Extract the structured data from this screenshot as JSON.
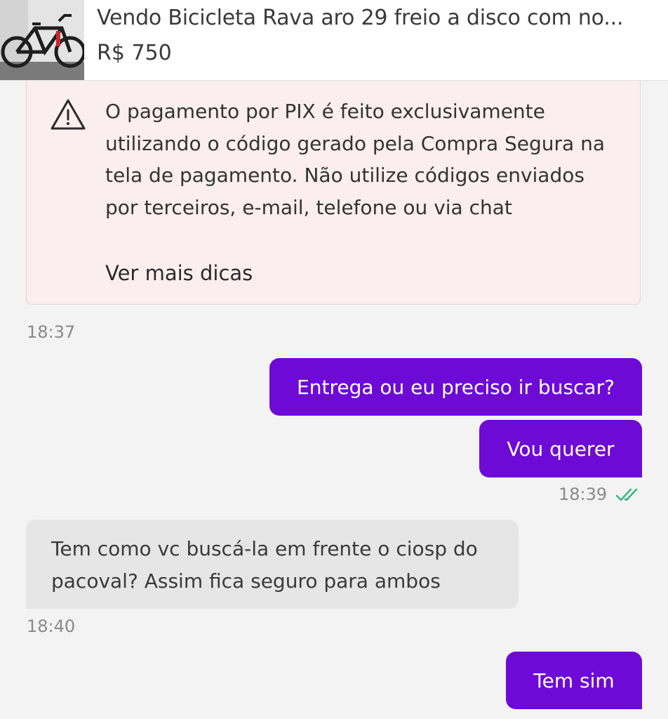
{
  "listing": {
    "title": "Vendo Bicicleta Rava aro 29 freio a disco com no...",
    "price": "R$ 750"
  },
  "warning": {
    "icon": "warning-triangle-icon",
    "text": "O pagamento por PIX é feito exclusivamente utilizando o código gerado pela Compra Segura na tela de pagamento. Não utilize códigos enviados por terceiros, e-mail, telefone ou via chat",
    "link": "Ver mais dicas",
    "colors": {
      "background": "#fbeeee",
      "border": "#e6d5d5"
    }
  },
  "messages": {
    "warning_time": "18:37",
    "sent_1": "Entrega ou eu preciso ir buscar?",
    "sent_2": "Vou querer",
    "sent_time": "18:39",
    "received_1": "Tem como vc buscá-la em frente o ciosp do pacoval? Assim fica seguro para ambos",
    "received_time": "18:40",
    "sent_3": "Tem sim"
  },
  "colors": {
    "sent_bubble": "#6e0ad6",
    "received_bubble": "#e6e6e6",
    "read_check": "#2eb67d",
    "chat_background": "#f3f3f3"
  }
}
